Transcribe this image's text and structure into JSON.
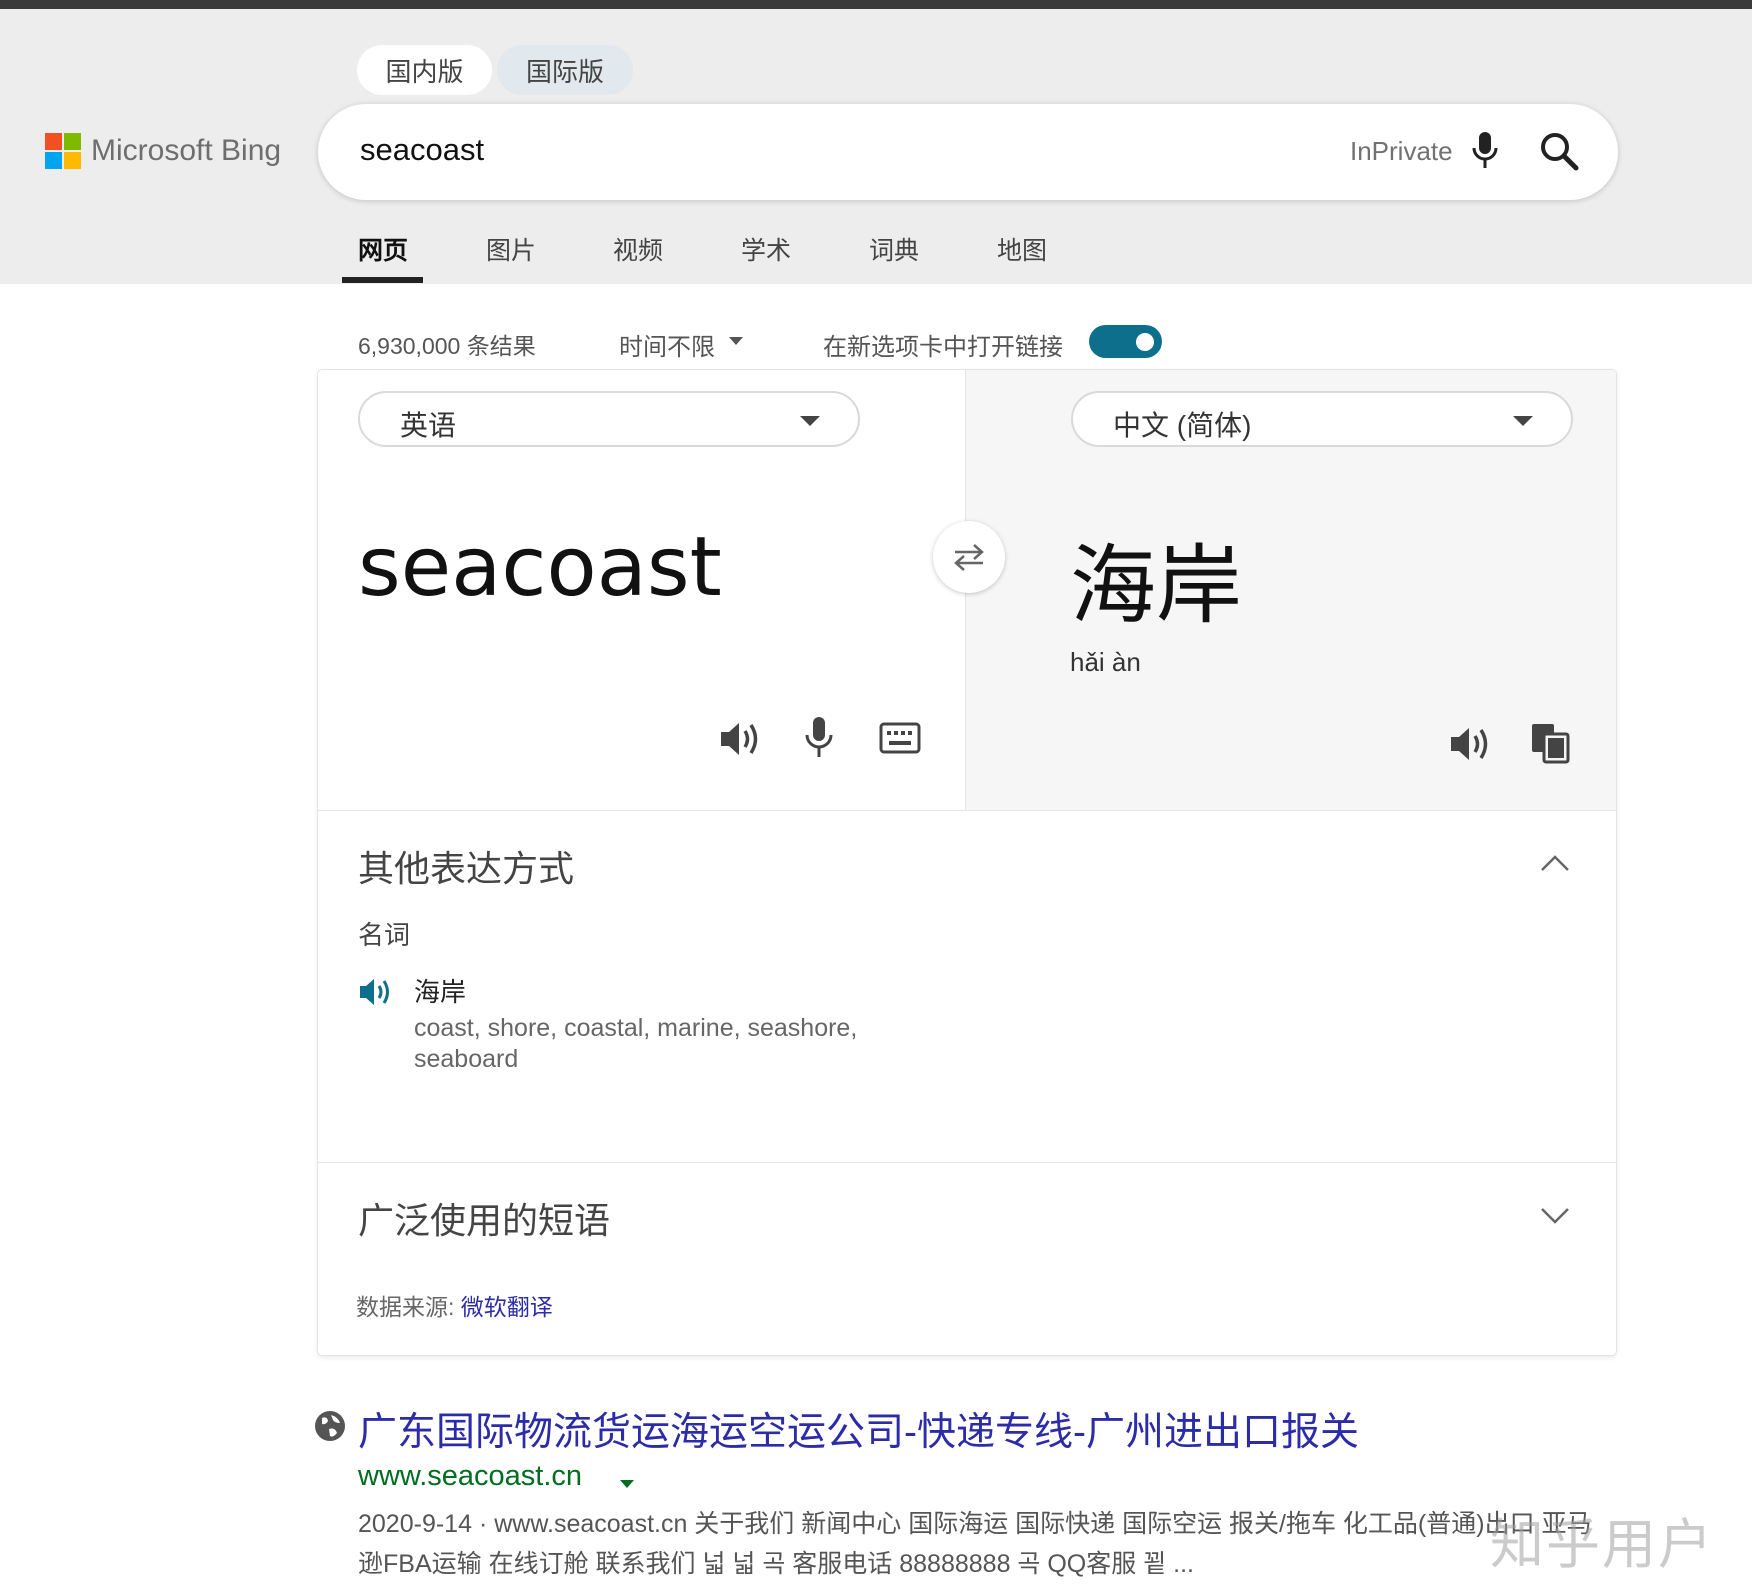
{
  "header": {
    "version_tabs": [
      "国内版",
      "国际版"
    ],
    "logo_text": "Microsoft Bing",
    "search_value": "seacoast",
    "inprivate": "InPrivate",
    "nav_tabs": [
      "网页",
      "图片",
      "视频",
      "学术",
      "词典",
      "地图"
    ],
    "active_tab": "网页"
  },
  "meta": {
    "result_count": "6,930,000 条结果",
    "time_filter": "时间不限",
    "open_new_tab_label": "在新选项卡中打开链接",
    "open_new_tab_on": true
  },
  "translator": {
    "source_lang": "英语",
    "target_lang": "中文 (简体)",
    "source_text": "seacoast",
    "target_text": "海岸",
    "pinyin": "hǎi àn",
    "other_expressions": {
      "title": "其他表达方式",
      "part_of_speech": "名词",
      "entries": [
        {
          "word": "海岸",
          "synonyms": "coast, shore, coastal, marine, seashore, seaboard"
        }
      ]
    },
    "common_phrases_title": "广泛使用的短语",
    "data_source_label": "数据来源:",
    "data_source_link": "微软翻译"
  },
  "result": {
    "title": "广东国际物流货运海运空运公司-快递专线-广州进出口报关",
    "url": "www.seacoast.cn",
    "date": "2020-9-14",
    "snippet": "www.seacoast.cn 关于我们 新闻中心 国际海运 国际快递 国际空运 报关/拖车 化工品(普通)出口 亚马逊FBA运输 在线订舱 联系我们 넓 넓 곡 客服电话 88888888 곡 QQ客服 꾙 ..."
  },
  "watermark": "知乎用户",
  "colors": {
    "accent": "#0e6f8d",
    "link": "#2c2ca8",
    "url_green": "#006d21"
  }
}
